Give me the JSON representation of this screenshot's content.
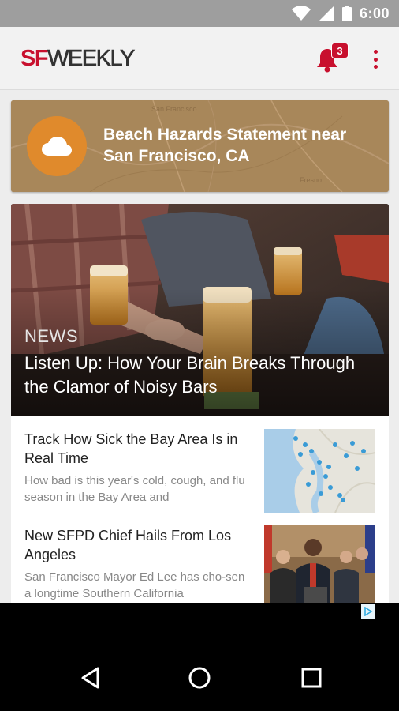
{
  "status_bar": {
    "time": "6:00",
    "icons": [
      "wifi-icon",
      "signal-icon",
      "battery-icon"
    ]
  },
  "app_bar": {
    "logo_sf": "SF",
    "logo_weekly": "WEEKLY",
    "notification_count": "3",
    "brand_color": "#c8102e"
  },
  "alert": {
    "text": "Beach Hazards Statement near San Francisco, CA",
    "icon": "cloud-icon",
    "map_labels": [
      "San Francisco",
      "Fresno"
    ],
    "circle_color": "#e08a2c"
  },
  "hero": {
    "category": "NEWS",
    "headline": "Listen Up: How Your Brain Breaks Through the Clamor of Noisy Bars"
  },
  "articles": [
    {
      "title": "Track How Sick the Bay Area Is in Real Time",
      "summary": "How bad is this year's cold, cough, and flu season in the Bay Area and"
    },
    {
      "title": "New SFPD Chief Hails From Los Angeles",
      "summary": "San Francisco Mayor Ed Lee has cho-sen a longtime Southern California"
    }
  ],
  "nav": {
    "back": "back-icon",
    "home": "home-icon",
    "recents": "recents-icon"
  }
}
